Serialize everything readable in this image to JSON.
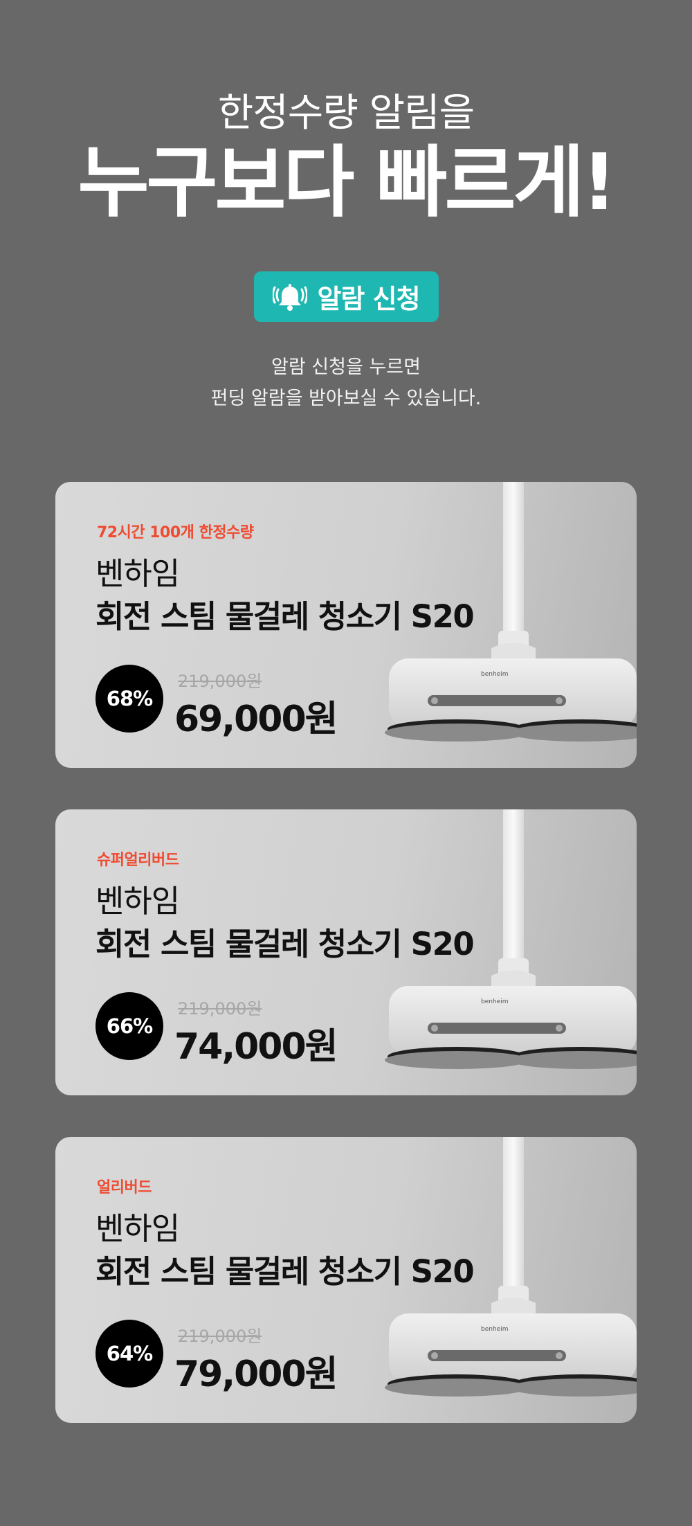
{
  "hero": {
    "sub_headline": "한정수량 알림을",
    "headline": "누구보다 빠르게!",
    "alarm_button_label": "알람 신청",
    "notice_line1": "알람 신청을 누르면",
    "notice_line2": "펀딩 알람을 받아보실 수 있습니다."
  },
  "colors": {
    "background": "#686868",
    "accent": "#1eb7b1",
    "tag": "#ef4b31"
  },
  "cards": [
    {
      "tag": "72시간 100개 한정수량",
      "brand": "벤하임",
      "model": "회전 스팀 물걸레 청소기 S20",
      "discount": "68%",
      "original_price": "219,000원",
      "price": "69,000원",
      "product_icon": "steam-mop-image"
    },
    {
      "tag": "슈퍼얼리버드",
      "brand": "벤하임",
      "model": "회전 스팀 물걸레 청소기 S20",
      "discount": "66%",
      "original_price": "219,000원",
      "price": "74,000원",
      "product_icon": "steam-mop-image"
    },
    {
      "tag": "얼리버드",
      "brand": "벤하임",
      "model": "회전 스팀 물걸레 청소기 S20",
      "discount": "64%",
      "original_price": "219,000원",
      "price": "79,000원",
      "product_icon": "steam-mop-image"
    }
  ]
}
